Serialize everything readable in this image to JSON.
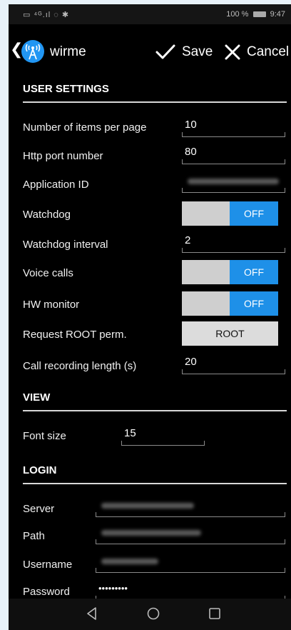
{
  "status": {
    "left": "▭ ⁴ᴳ.ıl ◌ ✱",
    "battery": "100 %",
    "time": "9:47"
  },
  "app": {
    "title": "wirme",
    "save_label": "Save",
    "cancel_label": "Cancel"
  },
  "sections": {
    "user_settings": "USER SETTINGS",
    "view": "VIEW",
    "login": "LOGIN"
  },
  "user_settings": {
    "items_per_page": {
      "label": "Number of items per page",
      "value": "10"
    },
    "http_port": {
      "label": "Http port number",
      "value": "80"
    },
    "application_id": {
      "label": "Application ID"
    },
    "watchdog": {
      "label": "Watchdog",
      "state": "OFF"
    },
    "watchdog_interval": {
      "label": "Watchdog interval",
      "value": "2"
    },
    "voice_calls": {
      "label": "Voice calls",
      "state": "OFF"
    },
    "hw_monitor": {
      "label": "HW monitor",
      "state": "OFF"
    },
    "root_perm": {
      "label": "Request ROOT perm.",
      "button": "ROOT"
    },
    "call_recording": {
      "label": "Call recording length (s)",
      "value": "20"
    }
  },
  "view": {
    "font_size": {
      "label": "Font size",
      "value": "15"
    }
  },
  "login": {
    "server": {
      "label": "Server"
    },
    "path": {
      "label": "Path"
    },
    "username": {
      "label": "Username"
    },
    "password": {
      "label": "Password",
      "value": "•••••••••"
    }
  },
  "colors": {
    "accent": "#1e90e8",
    "background": "#000000",
    "toggle_off": "#cfcfcf"
  },
  "icons": {
    "back": "chevron-left-icon",
    "app": "wifi-antenna-icon",
    "save": "checkmark-icon",
    "cancel": "close-x-icon",
    "nav": [
      "nav-back-icon",
      "nav-home-icon",
      "nav-recents-icon"
    ]
  }
}
